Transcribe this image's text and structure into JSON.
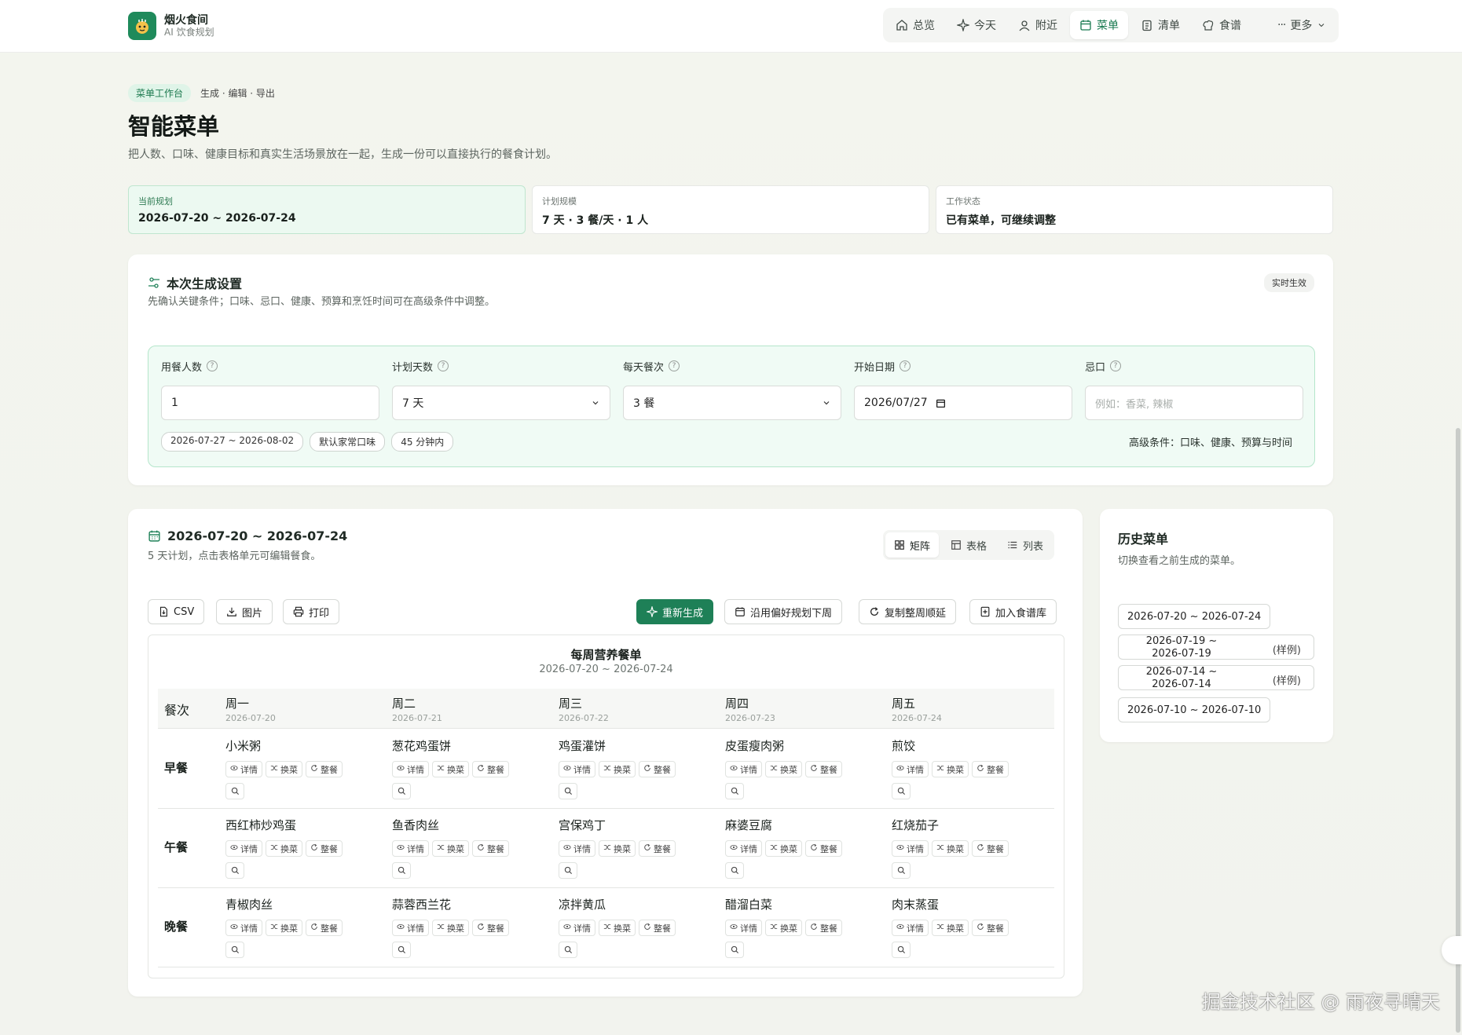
{
  "brand": {
    "name": "烟火食间",
    "sub": "AI 饮食规划"
  },
  "nav": [
    {
      "label": "总览",
      "icon": "home-icon",
      "active": false
    },
    {
      "label": "今天",
      "icon": "sparkle-icon",
      "active": false
    },
    {
      "label": "附近",
      "icon": "user-pin-icon",
      "active": false
    },
    {
      "label": "菜单",
      "icon": "calendar-icon",
      "active": true
    },
    {
      "label": "清单",
      "icon": "clipboard-icon",
      "active": false
    },
    {
      "label": "食谱",
      "icon": "chef-hat-icon",
      "active": false
    },
    {
      "label": "更多",
      "icon": "more-icon",
      "active": false
    }
  ],
  "eyebrow": {
    "chip": "菜单工作台",
    "text": "生成 · 编辑 · 导出"
  },
  "page": {
    "title": "智能菜单",
    "desc": "把人数、口味、健康目标和真实生活场景放在一起，生成一份可以直接执行的餐食计划。"
  },
  "stats": [
    {
      "label": "当前规划",
      "value": "2026-07-20 ~ 2026-07-24"
    },
    {
      "label": "计划规模",
      "value": "7 天 · 3 餐/天 · 1 人"
    },
    {
      "label": "工作状态",
      "value": "已有菜单，可继续调整"
    }
  ],
  "settings": {
    "title": "本次生成设置",
    "desc": "先确认关键条件；口味、忌口、健康、预算和烹饪时间可在高级条件中调整。",
    "badge": "实时生效",
    "fields": [
      {
        "label": "用餐人数",
        "value": "1"
      },
      {
        "label": "计划天数",
        "value": "7 天"
      },
      {
        "label": "每天餐次",
        "value": "3 餐"
      },
      {
        "label": "开始日期",
        "value": "2026/07/27"
      },
      {
        "label": "忌口",
        "placeholder": "例如：香菜, 辣椒"
      }
    ],
    "tags": [
      "2026-07-27 ~ 2026-08-02",
      "默认家常口味",
      "45 分钟内"
    ],
    "advanced": "高级条件：口味、健康、预算与时间"
  },
  "menu": {
    "title": "2026-07-20 ~ 2026-07-24",
    "desc": "5 天计划，点击表格单元可编辑餐食。",
    "views": [
      "矩阵",
      "表格",
      "列表"
    ],
    "toolbar": {
      "csv": "CSV",
      "image": "图片",
      "print": "打印",
      "regenerate": "重新生成",
      "next_week": "沿用偏好规划下周",
      "copy_week": "复制整周顺延",
      "add_library": "加入食谱库"
    },
    "table_title": "每周营养餐单",
    "table_sub": "2026-07-20 ~ 2026-07-24",
    "meal_header": "餐次",
    "days": [
      {
        "day": "周一",
        "date": "2026-07-20"
      },
      {
        "day": "周二",
        "date": "2026-07-21"
      },
      {
        "day": "周三",
        "date": "2026-07-22"
      },
      {
        "day": "周四",
        "date": "2026-07-23"
      },
      {
        "day": "周五",
        "date": "2026-07-24"
      }
    ],
    "actions": {
      "detail": "详情",
      "swap": "换菜",
      "whole": "整餐"
    },
    "rows": [
      {
        "meal": "早餐",
        "dishes": [
          "小米粥",
          "葱花鸡蛋饼",
          "鸡蛋灌饼",
          "皮蛋瘦肉粥",
          "煎饺"
        ]
      },
      {
        "meal": "午餐",
        "dishes": [
          "西红柿炒鸡蛋",
          "鱼香肉丝",
          "宫保鸡丁",
          "麻婆豆腐",
          "红烧茄子"
        ]
      },
      {
        "meal": "晚餐",
        "dishes": [
          "青椒肉丝",
          "蒜蓉西兰花",
          "凉拌黄瓜",
          "醋溜白菜",
          "肉末蒸蛋"
        ]
      }
    ]
  },
  "history": {
    "title": "历史菜单",
    "desc": "切换查看之前生成的菜单。",
    "items": [
      {
        "range": "2026-07-20 ~ 2026-07-24"
      },
      {
        "range": "2026-07-19 ~ 2026-07-19",
        "sample": "(样例)"
      },
      {
        "range": "2026-07-14 ~ 2026-07-14",
        "sample": "(样例)"
      },
      {
        "range": "2026-07-10 ~ 2026-07-10"
      }
    ]
  },
  "watermark": "掘金技术社区 @ 雨夜寻晴天",
  "colors": {
    "brand": "#1e8057",
    "accent_bg": "#f0fbf5",
    "accent_border": "#b5e6cb"
  }
}
